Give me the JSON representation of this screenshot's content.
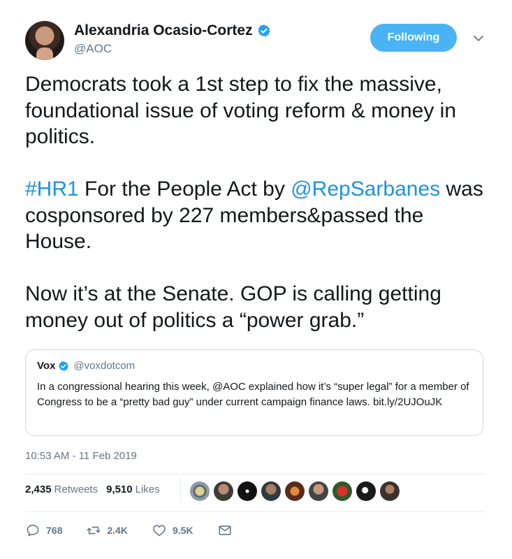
{
  "author": {
    "display_name": "Alexandria Ocasio-Cortez",
    "handle": "@AOC",
    "follow_label": "Following"
  },
  "tweet": {
    "paragraphs": [
      {
        "text": "Democrats took a 1st step to fix the massive, foundational issue of voting reform & money in politics."
      },
      {
        "hashtag": "#HR1",
        "mid": " For the People Act by ",
        "mention": "@RepSarbanes",
        "tail": " was cosponsored by 227 members&passed the House."
      },
      {
        "text": "Now it’s at the Senate. GOP is calling getting money out of politics a “power grab.”"
      }
    ]
  },
  "quoted_tweet": {
    "name": "Vox",
    "handle": "@voxdotcom",
    "text": "In a congressional hearing this week, @AOC explained how it’s “super legal” for a member of Congress to be a “pretty bad guy” under current campaign finance laws. bit.ly/2UJOuJK"
  },
  "timestamp": "10:53 AM - 11 Feb 2019",
  "stats": {
    "retweets_count": "2,435",
    "retweets_label": "Retweets",
    "likes_count": "9,510",
    "likes_label": "Likes"
  },
  "actions": {
    "reply_count": "768",
    "retweet_count": "2.4K",
    "like_count": "9.5K"
  },
  "colors": {
    "accent": "#1b95e0",
    "follow_button": "#4ab3f4",
    "muted": "#657786"
  },
  "icons": {
    "verified": "verified-badge-icon",
    "caret": "chevron-down-icon",
    "reply": "reply-icon",
    "retweet": "retweet-icon",
    "like": "heart-icon",
    "dm": "envelope-icon"
  }
}
